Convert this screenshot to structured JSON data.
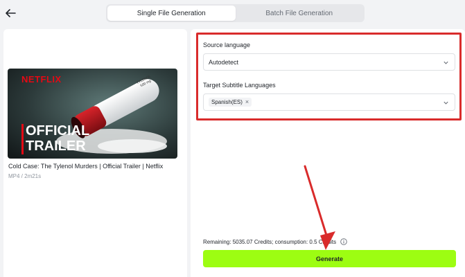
{
  "header": {
    "back_icon": "arrow-left-icon",
    "tabs": [
      {
        "label": "Single File Generation",
        "active": true
      },
      {
        "label": "Batch File Generation",
        "active": false
      }
    ]
  },
  "video": {
    "thumbnail_brand": "NETFLIX",
    "thumbnail_text_line1": "OFFICIAL",
    "thumbnail_text_line2": "TRAILER",
    "pill_text": "TYLENOL 500 mg",
    "title": "Cold Case: The Tylenol Murders | Official Trailer | Netflix",
    "meta": "MP4 / 2m21s"
  },
  "form": {
    "source_language_label": "Source language",
    "source_language_value": "Autodetect",
    "target_label": "Target Subtitle Languages",
    "target_tags": [
      "Spanish(ES)"
    ]
  },
  "footer": {
    "credits_text": "Remaining: 5035.07 Credits; consumption: 0.5 Credits",
    "generate_label": "Generate"
  },
  "colors": {
    "accent": "#9dfd12",
    "highlight": "#d92b2b",
    "netflix_red": "#e50914"
  }
}
